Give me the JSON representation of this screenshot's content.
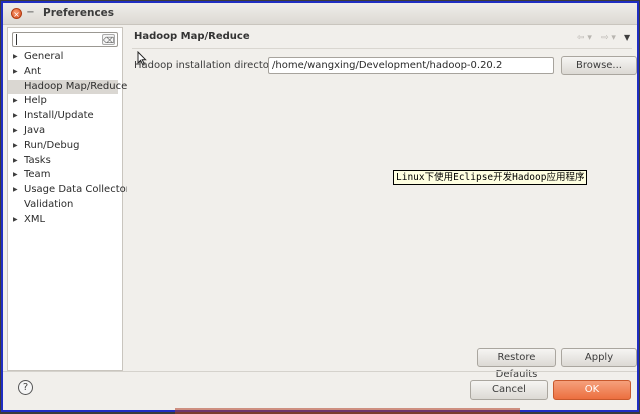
{
  "window": {
    "title": "Preferences",
    "close_glyph": "×",
    "minimize_glyph": "−"
  },
  "sidebar": {
    "filter_value": "",
    "filter_clear_glyph": "⌫",
    "items": [
      {
        "label": "General",
        "expandable": true
      },
      {
        "label": "Ant",
        "expandable": true
      },
      {
        "label": "Hadoop Map/Reduce",
        "expandable": false,
        "selected": true
      },
      {
        "label": "Help",
        "expandable": true
      },
      {
        "label": "Install/Update",
        "expandable": true
      },
      {
        "label": "Java",
        "expandable": true
      },
      {
        "label": "Run/Debug",
        "expandable": true
      },
      {
        "label": "Tasks",
        "expandable": true
      },
      {
        "label": "Team",
        "expandable": true
      },
      {
        "label": "Usage Data Collector",
        "expandable": true
      },
      {
        "label": "Validation",
        "expandable": false
      },
      {
        "label": "XML",
        "expandable": true
      }
    ],
    "arrow_glyph": "▶"
  },
  "content": {
    "page_title": "Hadoop Map/Reduce",
    "nav_back_glyph": "⇦ ▾",
    "nav_forward_glyph": "⇨ ▾",
    "nav_menu_glyph": "▼",
    "install_dir_label": "Hadoop installation directory:",
    "install_dir_value": "/home/wangxing/Development/hadoop-0.20.2",
    "browse_label": "Browse...",
    "tooltip_text": "Linux下使用Eclipse开发Hadoop应用程序",
    "restore_defaults_label": "Restore Defaults",
    "apply_label": "Apply"
  },
  "footer": {
    "help_glyph": "?",
    "cancel_label": "Cancel",
    "ok_label": "OK"
  },
  "colors": {
    "window_border": "#1f2dc2",
    "ok_button": "#ec6f3f",
    "tooltip_bg": "#ffffe1",
    "selected_item_bg": "#dad7d2"
  }
}
